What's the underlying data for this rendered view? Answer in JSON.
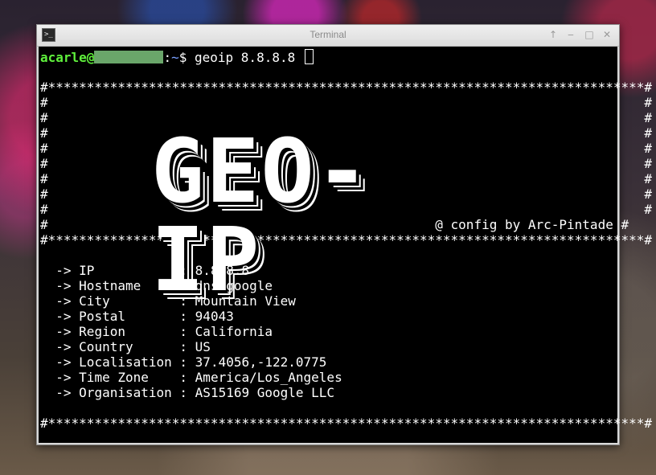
{
  "window": {
    "title": "Terminal",
    "controls": {
      "pin": "↑",
      "minimize": "‒",
      "maximize": "□",
      "close": "✕"
    }
  },
  "prompt": {
    "user": "acarle@",
    "path": "~",
    "separator": ":",
    "symbol": "$",
    "command": "geoip 8.8.8.8"
  },
  "banner": {
    "border_top": "#*****************************************************************************#",
    "side_line": "#                                                                             #",
    "credit_line": "#                                                  @ config by Arc-Pintade #",
    "border_bottom": "#*****************************************************************************#",
    "art_text": "GEO-IP"
  },
  "results": [
    {
      "arrow": "->",
      "label": "IP          ",
      "value": "8.8.8.8"
    },
    {
      "arrow": "->",
      "label": "Hostname    ",
      "value": "dns.google"
    },
    {
      "arrow": "->",
      "label": "City        ",
      "value": "Mountain View"
    },
    {
      "arrow": "->",
      "label": "Postal      ",
      "value": "94043"
    },
    {
      "arrow": "->",
      "label": "Region      ",
      "value": "California"
    },
    {
      "arrow": "->",
      "label": "Country     ",
      "value": "US"
    },
    {
      "arrow": "->",
      "label": "Localisation",
      "value": "37.4056,-122.0775"
    },
    {
      "arrow": "->",
      "label": "Time Zone   ",
      "value": "America/Los_Angeles"
    },
    {
      "arrow": "->",
      "label": "Organisation",
      "value": "AS15169 Google LLC"
    }
  ],
  "footer": {
    "border": "#*****************************************************************************#"
  },
  "colors": {
    "prompt_user": "#5ff03c",
    "terminal_bg": "#000000",
    "terminal_fg": "#ffffff"
  }
}
